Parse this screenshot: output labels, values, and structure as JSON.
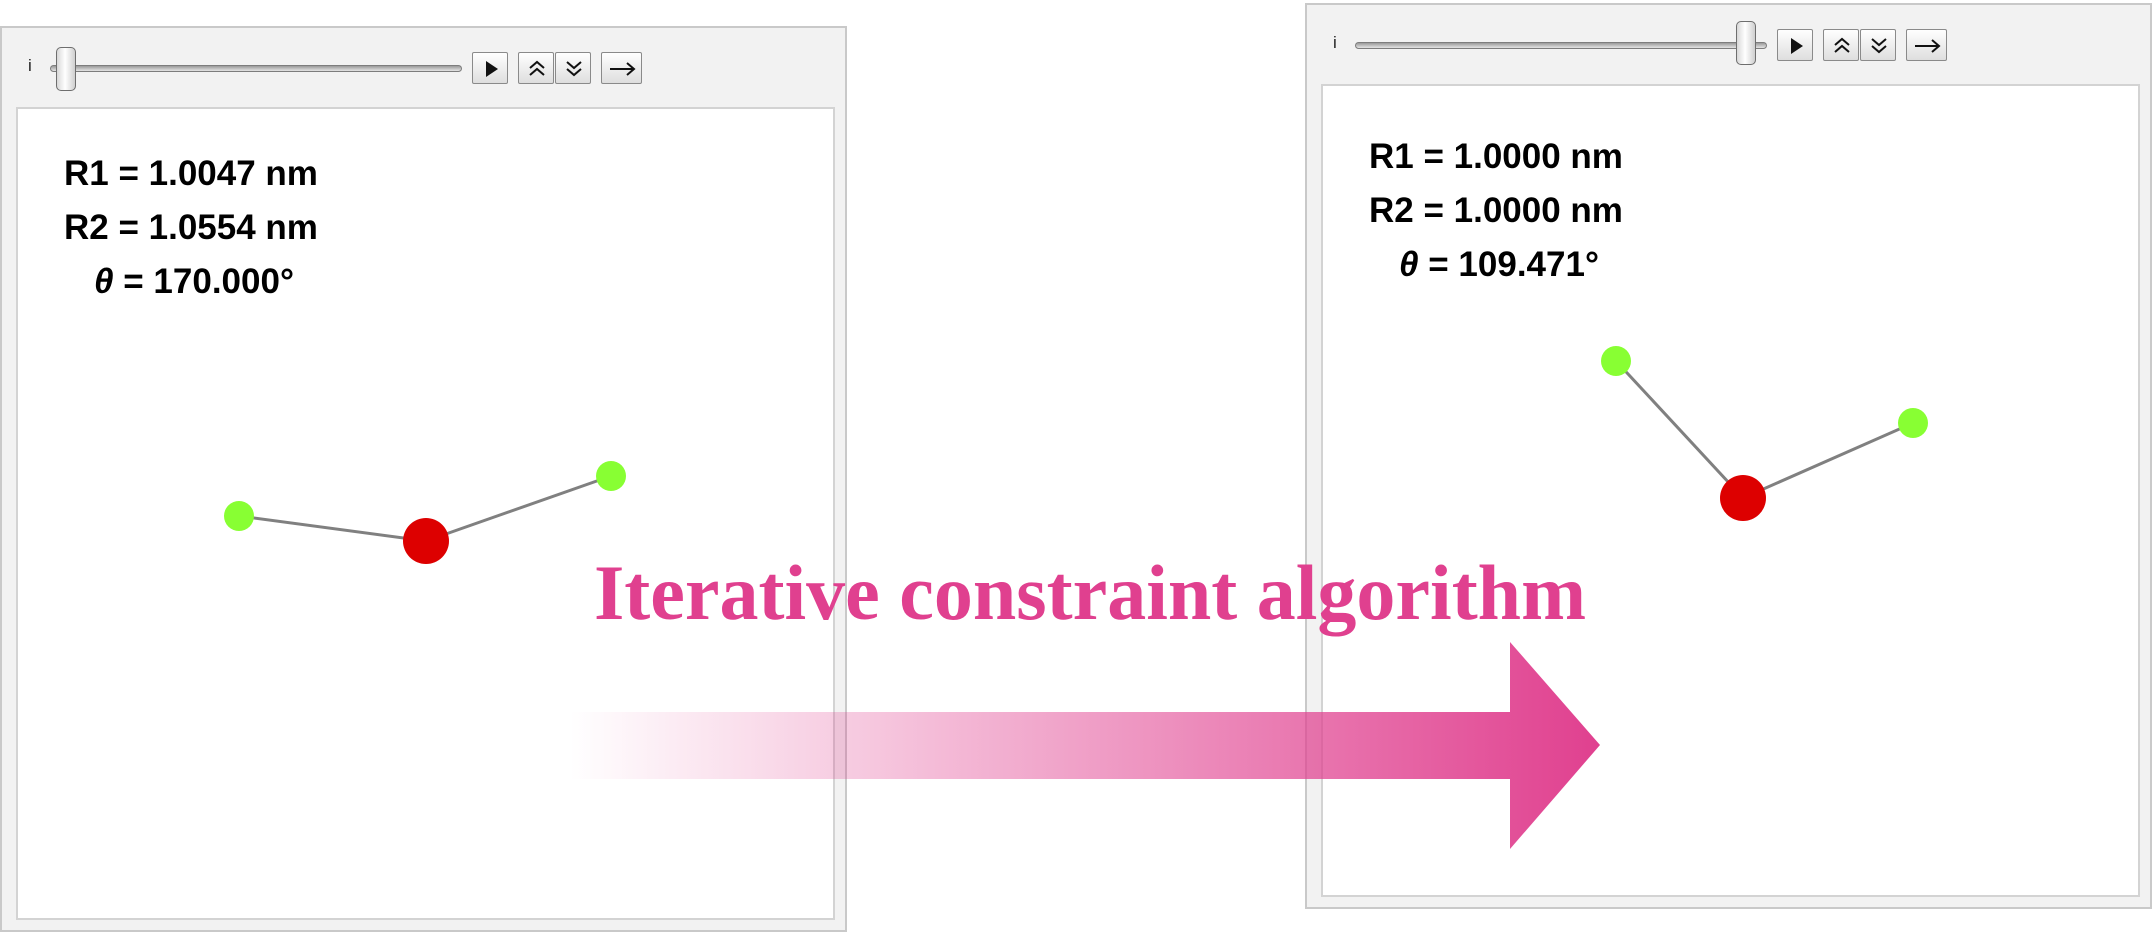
{
  "panels": [
    {
      "slider": {
        "label": "i",
        "position": 0.0
      },
      "controls": {
        "play": "play-icon",
        "faster": "double-up-icon",
        "slower": "double-down-icon",
        "step": "right-arrow-icon"
      },
      "readout": {
        "r1_label": "R1 = ",
        "r1_value": "1.0047 nm",
        "r2_label": "R2 = ",
        "r2_value": "1.0554 nm",
        "theta_symbol": "θ",
        "theta_eq": " = ",
        "theta_value": "170.000°"
      },
      "molecule": {
        "center_color": "#dd0000",
        "terminal_color": "#88ff33",
        "bond_color": "#808080"
      }
    },
    {
      "slider": {
        "label": "i",
        "position": 1.0
      },
      "controls": {
        "play": "play-icon",
        "faster": "double-up-icon",
        "slower": "double-down-icon",
        "step": "right-arrow-icon"
      },
      "readout": {
        "r1_label": "R1 = ",
        "r1_value": "1.0000 nm",
        "r2_label": "R2 = ",
        "r2_value": "1.0000 nm",
        "theta_symbol": "θ",
        "theta_eq": " = ",
        "theta_value": "109.471°"
      },
      "molecule": {
        "center_color": "#dd0000",
        "terminal_color": "#88ff33",
        "bond_color": "#808080"
      }
    }
  ],
  "annotation": {
    "caption": "Iterative constraint algorithm",
    "accent_color": "#e0408f"
  }
}
